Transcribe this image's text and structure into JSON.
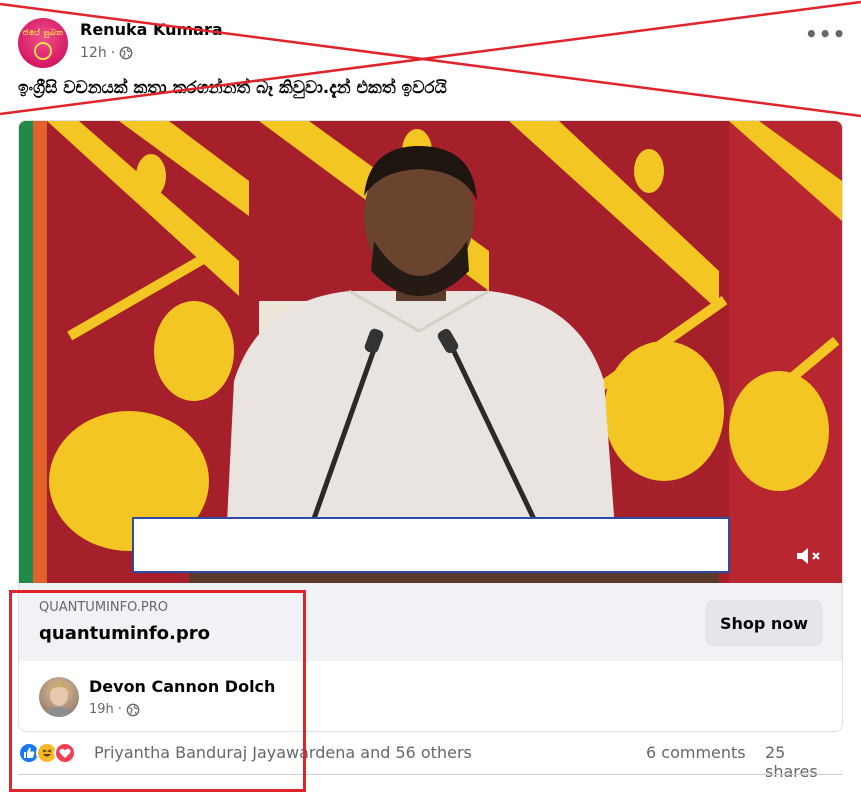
{
  "post": {
    "author": "Renuka Kumara",
    "time": "12h",
    "privacy_icon": "globe-icon",
    "more_label": "•••",
    "text": "ඉංග්‍රීසි වචනයක් කතා කරගන්නත් බෑ කිවුවා.දැන් එකත් ඉවරයි",
    "avatar_logo_text": "ජයේ සුබත"
  },
  "ad": {
    "domain_caps": "QUANTUMINFO.PRO",
    "link_title": "quantuminfo.pro",
    "cta_label": "Shop now",
    "mute_icon": "speaker-muted-icon",
    "sharer": {
      "name": "Devon Cannon Dolch",
      "time": "19h"
    }
  },
  "reactions": {
    "icons": [
      "like-reaction-icon",
      "haha-reaction-icon",
      "love-reaction-icon"
    ],
    "names": "Priyantha Banduraj Jayawardena and 56 others",
    "comments": "6 comments",
    "shares": "25 shares"
  },
  "annotations": {
    "strike_color": "#e0242b",
    "highlight_color": "#e0242b"
  },
  "colors": {
    "flag_maroon": "#a5202a",
    "flag_yellow": "#f3c623",
    "flag_orange": "#e2622b",
    "caption_border": "#2f4aa6",
    "muted_text": "#65676b"
  }
}
